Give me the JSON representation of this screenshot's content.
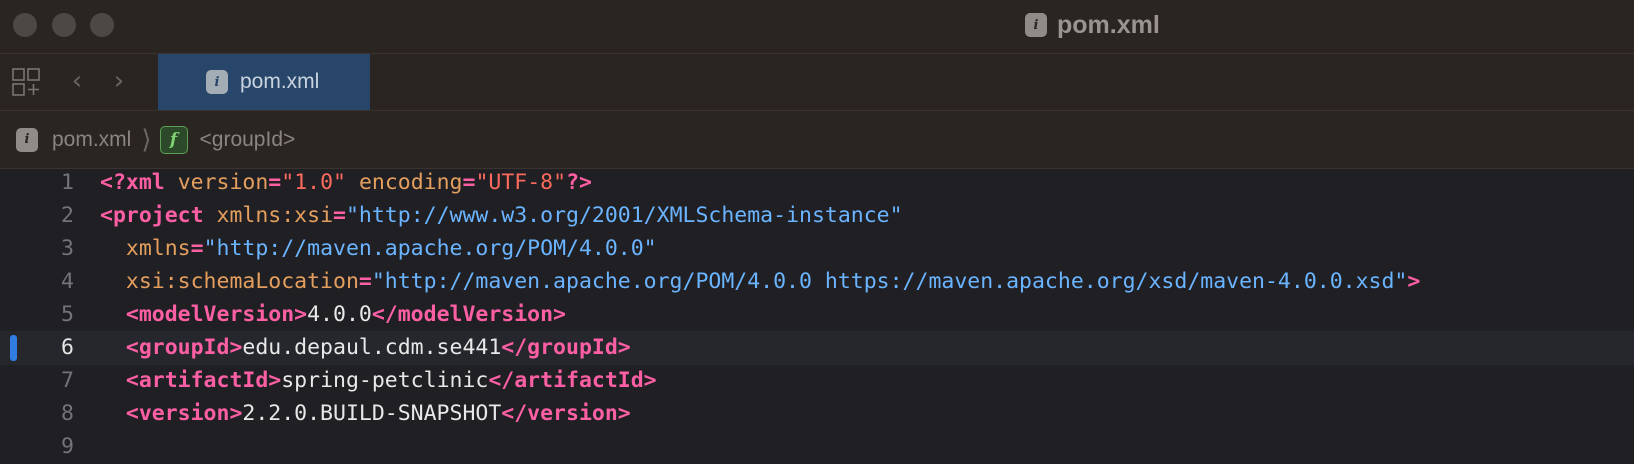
{
  "window": {
    "title": "pom.xml",
    "file_icon_glyph": "i"
  },
  "tabbar": {
    "back_glyph": "‹",
    "forward_glyph": "›",
    "active_tab_label": "pom.xml"
  },
  "breadcrumb": {
    "file_label": "pom.xml",
    "separator": "⟩",
    "f_icon_glyph": "f",
    "element_label": "<groupId>"
  },
  "editor": {
    "current_line": 6,
    "line_numbers": [
      "1",
      "2",
      "3",
      "4",
      "5",
      "6",
      "7",
      "8",
      "9"
    ],
    "lines": [
      {
        "n": "1",
        "tokens": [
          {
            "c": "tg",
            "t": "<?xml"
          },
          {
            "c": "txt",
            "t": " "
          },
          {
            "c": "at",
            "t": "version"
          },
          {
            "c": "tg",
            "t": "="
          },
          {
            "c": "str",
            "t": "\"1.0\""
          },
          {
            "c": "txt",
            "t": " "
          },
          {
            "c": "at",
            "t": "encoding"
          },
          {
            "c": "tg",
            "t": "="
          },
          {
            "c": "str",
            "t": "\"UTF-8\""
          },
          {
            "c": "tg",
            "t": "?>"
          }
        ]
      },
      {
        "n": "2",
        "tokens": [
          {
            "c": "tg",
            "t": "<project"
          },
          {
            "c": "txt",
            "t": " "
          },
          {
            "c": "at",
            "t": "xmlns:xsi"
          },
          {
            "c": "tg",
            "t": "="
          },
          {
            "c": "url",
            "t": "\"http://www.w3.org/2001/XMLSchema-instance\""
          }
        ]
      },
      {
        "n": "3",
        "tokens": [
          {
            "c": "txt",
            "t": "  "
          },
          {
            "c": "at",
            "t": "xmlns"
          },
          {
            "c": "tg",
            "t": "="
          },
          {
            "c": "url",
            "t": "\"http://maven.apache.org/POM/4.0.0\""
          }
        ]
      },
      {
        "n": "4",
        "tokens": [
          {
            "c": "txt",
            "t": "  "
          },
          {
            "c": "at",
            "t": "xsi:schemaLocation"
          },
          {
            "c": "tg",
            "t": "="
          },
          {
            "c": "url",
            "t": "\"http://maven.apache.org/POM/4.0.0 https://maven.apache.org/xsd/maven-4.0.0.xsd\""
          },
          {
            "c": "tg",
            "t": ">"
          }
        ]
      },
      {
        "n": "5",
        "tokens": [
          {
            "c": "txt",
            "t": "  "
          },
          {
            "c": "tg",
            "t": "<modelVersion>"
          },
          {
            "c": "txt",
            "t": "4.0.0"
          },
          {
            "c": "tg",
            "t": "</modelVersion>"
          }
        ]
      },
      {
        "n": "6",
        "tokens": [
          {
            "c": "txt",
            "t": "  "
          },
          {
            "c": "tg",
            "t": "<groupId>"
          },
          {
            "c": "txt",
            "t": "edu.depaul.cdm.se441"
          },
          {
            "c": "tg",
            "t": "</groupId>"
          }
        ]
      },
      {
        "n": "7",
        "tokens": [
          {
            "c": "txt",
            "t": "  "
          },
          {
            "c": "tg",
            "t": "<artifactId>"
          },
          {
            "c": "txt",
            "t": "spring-petclinic"
          },
          {
            "c": "tg",
            "t": "</artifactId>"
          }
        ]
      },
      {
        "n": "8",
        "tokens": [
          {
            "c": "txt",
            "t": "  "
          },
          {
            "c": "tg",
            "t": "<version>"
          },
          {
            "c": "txt",
            "t": "2.2.0.BUILD-SNAPSHOT"
          },
          {
            "c": "tg",
            "t": "</version>"
          }
        ]
      },
      {
        "n": "9",
        "tokens": []
      }
    ]
  },
  "colors": {
    "chrome_bg": "#2b2522",
    "editor_bg": "#1f1f24",
    "active_tab_bg": "#284669",
    "tag": "#fc5fa3",
    "attribute": "#e49f5e",
    "string": "#fc6a5d",
    "url": "#6bb4ff",
    "change_marker": "#2f7de1"
  }
}
